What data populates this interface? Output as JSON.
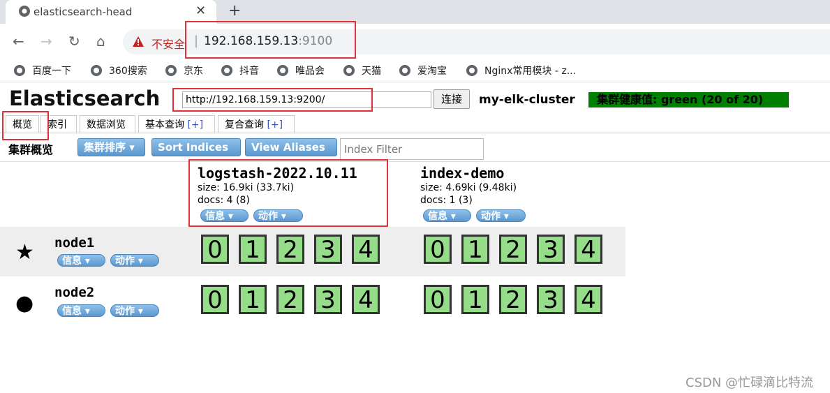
{
  "browser": {
    "tab_title": "elasticsearch-head",
    "close_glyph": "✕",
    "new_tab_glyph": "+",
    "insecure_label": "不安全",
    "separator": "|",
    "url_host": "192.168.159.13",
    "url_port": ":9100",
    "bookmarks": [
      "百度一下",
      "360搜索",
      "京东",
      "抖音",
      "唯品会",
      "天猫",
      "爱淘宝",
      "Nginx常用模块 - z..."
    ]
  },
  "es": {
    "title": "Elasticsearch",
    "cluster_url": "http://192.168.159.13:9200/",
    "connect_label": "连接",
    "cluster_name": "my-elk-cluster",
    "health": "集群健康值: green (20 of 20)",
    "tabs": [
      {
        "label": "概览",
        "plus": ""
      },
      {
        "label": "索引",
        "plus": ""
      },
      {
        "label": "数据浏览",
        "plus": ""
      },
      {
        "label": "基本查询",
        "plus": "[+]"
      },
      {
        "label": "复合查询",
        "plus": "[+]"
      }
    ],
    "overview_label": "集群概览",
    "sort_cluster_label": "集群排序 ▾",
    "sort_indices_label": "Sort Indices ▾",
    "view_aliases_label": "View Aliases ▾",
    "index_filter_placeholder": "Index Filter",
    "info_label": "信息 ▾",
    "action_label": "动作 ▾",
    "indices": [
      {
        "name": "logstash-2022.10.11",
        "size": "size: 16.9ki (33.7ki)",
        "docs": "docs: 4 (8)"
      },
      {
        "name": "index-demo",
        "size": "size: 4.69ki (9.48ki)",
        "docs": "docs: 1 (3)"
      }
    ],
    "nodes": [
      {
        "name": "node1",
        "marker": "★",
        "shards": [
          "0",
          "1",
          "2",
          "3",
          "4",
          "0",
          "1",
          "2",
          "3",
          "4"
        ]
      },
      {
        "name": "node2",
        "marker": "●",
        "shards": [
          "0",
          "1",
          "2",
          "3",
          "4",
          "0",
          "1",
          "2",
          "3",
          "4"
        ]
      }
    ]
  },
  "watermark": "CSDN @忙碌滴比特流",
  "colors": {
    "health_green": "#008000",
    "shard_green": "#96dd8a",
    "highlight_red": "#e3303a"
  }
}
